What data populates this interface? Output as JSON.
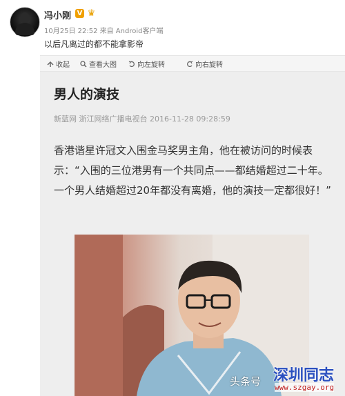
{
  "post": {
    "username": "冯小刚",
    "verified_badge": "V",
    "rank_badge_icon": "crown-icon",
    "meta": "10月25日 22:52 来自 Android客户端",
    "text": "以后凡离过的都不能拿影帝"
  },
  "toolbar": {
    "items": [
      {
        "label": "收起",
        "icon": "collapse-arrow-icon"
      },
      {
        "label": "查看大图",
        "icon": "magnify-icon"
      },
      {
        "label": "向左旋转",
        "icon": "rotate-left-icon"
      },
      {
        "label": "向右旋转",
        "icon": "rotate-right-icon"
      }
    ]
  },
  "article": {
    "title": "男人的演技",
    "source": "新蓝网 浙江网络广播电视台 2016-11-28 09:28:59",
    "body": "香港谐星许冠文入围金马奖男主角，他在被访问的时候表示：“入围的三位港男有一个共同点——都结婚超过二十年。一个男人结婚超过20年都没有离婚，他的演技一定都很好！”"
  },
  "watermarks": {
    "toutiao": "头条号",
    "site_name": "深圳同志",
    "site_url": "www.szgay.org"
  },
  "colors": {
    "vip_badge": "#f0a000",
    "watermark_blue": "#2a4fbf",
    "watermark_red": "#c02020"
  }
}
